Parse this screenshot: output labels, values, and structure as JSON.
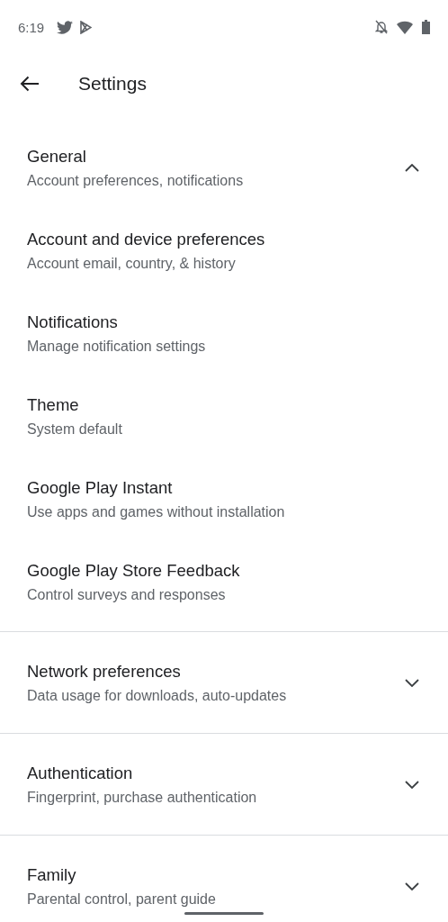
{
  "status_bar": {
    "time": "6:19"
  },
  "app_bar": {
    "title": "Settings"
  },
  "sections": [
    {
      "title": "General",
      "subtitle": "Account preferences, notifications",
      "expanded": true,
      "items": [
        {
          "title": "Account and device preferences",
          "subtitle": "Account email, country, & history"
        },
        {
          "title": "Notifications",
          "subtitle": "Manage notification settings"
        },
        {
          "title": "Theme",
          "subtitle": "System default"
        },
        {
          "title": "Google Play Instant",
          "subtitle": "Use apps and games without installation"
        },
        {
          "title": "Google Play Store Feedback",
          "subtitle": "Control surveys and responses"
        }
      ]
    },
    {
      "title": "Network preferences",
      "subtitle": "Data usage for downloads, auto-updates",
      "expanded": false
    },
    {
      "title": "Authentication",
      "subtitle": "Fingerprint, purchase authentication",
      "expanded": false
    },
    {
      "title": "Family",
      "subtitle": "Parental control, parent guide",
      "expanded": false
    }
  ]
}
